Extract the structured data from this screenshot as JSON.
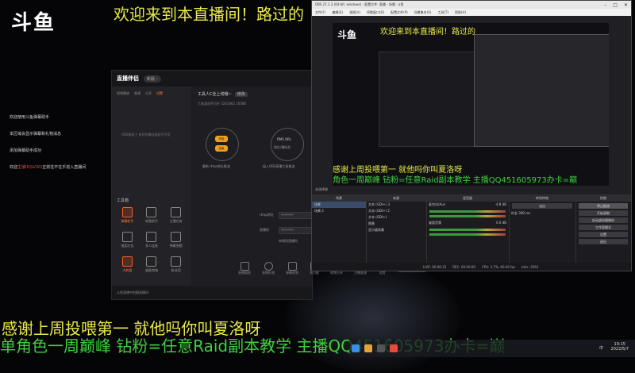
{
  "overlay": {
    "logo": "斗鱼",
    "top_ticker": "欢迎来到本直播间！路过的",
    "bottom_ticker_yellow": "感谢上周投喂第一 就他吗你叫夏洛呀",
    "bottom_ticker_green": "单角色一周巅峰 钻粉=任意Raid副本教学 主播QQ451605973办卡=巅"
  },
  "chat": {
    "lines": [
      {
        "text": "欢迎使用斗鱼弹幕助手",
        "highlight": ""
      },
      {
        "text": "本区域会显示弹幕和礼物消息",
        "highlight": ""
      },
      {
        "text": "添加弹幕助手成功",
        "highlight": ""
      },
      {
        "text": "欢迎",
        "highlight": "主播ID(LV30)"
      }
    ],
    "last_suffix": "正前往不在乎进入直播间"
  },
  "assistant": {
    "brand": "直播伴侣",
    "version_pill": "新版 ›",
    "tabs": [
      "视频播放",
      "普通",
      "分享",
      "设置"
    ],
    "active_tab": 3,
    "display_note": "OBS推流下 有好的最佳画质不可用",
    "room_title": "工具人C全上线哦~",
    "room_tag": "修改",
    "room_sub": "工具游戏不可开    3241662    16580",
    "btn_a": "开始",
    "btn_b": "结束",
    "rtmp_label": "RMS URL",
    "rtmp_sub": "地址/播码后",
    "hint_left": "重新 rtmp地址推流",
    "hint_right": "接入OBS直播工具推流",
    "field1_label": "rtmp地址",
    "field1_value": "********",
    "field2_label": "直播码",
    "field2_value": "********",
    "field_hint": "申请到直播码",
    "tools_header": "工具箱",
    "tools": [
      {
        "label": "弹幕助手",
        "active": true
      },
      {
        "label": "房管助手",
        "active": false
      },
      {
        "label": "主播任务",
        "active": false
      },
      {
        "label": "抽奖红包",
        "active": false
      },
      {
        "label": "多人连麦",
        "active": false
      },
      {
        "label": "弹幕答题",
        "active": false
      },
      {
        "label": "大转盘",
        "active": true
      },
      {
        "label": "福星商城",
        "active": false
      },
      {
        "label": "粉丝团",
        "active": false
      }
    ],
    "footer": "斗鱼直播中拍摄直播间",
    "bottom_icons": [
      "直播管理",
      "直播礼物",
      "弹幕视频",
      "多功能",
      "视频分享",
      "主播管理",
      "设置"
    ],
    "start_button": "开始直播"
  },
  "obs": {
    "window_title": "OBS 27.1.3 (64-bit, windows) - 配置文件: 直播 - 场景: 斗鱼",
    "menu": [
      "文件(F)",
      "编辑(E)",
      "视图(V)",
      "停靠窗口(D)",
      "配置文件(P)",
      "场景集合(S)",
      "工具(T)",
      "帮助(H)"
    ],
    "preview_title": "欢迎来到本直播间！路过的",
    "preview_yellow": "感谢上周投喂第一 就他吗你叫夏洛呀",
    "preview_green": "角色一周巅峰 钻粉=任意Raid副本教学 主播QQ451605973办卡=巅",
    "source_bar": "未选择源",
    "scenes_header": "场景",
    "scenes": [
      "场景",
      "场景 2"
    ],
    "sources_header": "来源",
    "sources": [
      "文本 (GDI+) 3",
      "文本 (GDI+) 2",
      "文本 (GDI+)",
      "图像",
      "显示器采集"
    ],
    "mixer_header": "混音器",
    "mixer": [
      {
        "name": "麦克风/Aux",
        "db": "-4.8 dB"
      },
      {
        "name": "桌面音频",
        "db": "0.0 dB"
      }
    ],
    "transition_header": "转场特效",
    "transition_name": "淡出",
    "duration_label": "时长",
    "duration_value": "300 ms",
    "controls_header": "控制",
    "controls": [
      "停止推流",
      "开始录制",
      "启动虚拟摄像机",
      "工作室模式",
      "设置",
      "退出"
    ],
    "status": [
      "LIVE: 00:06:32",
      "REC: 00:00:00",
      "CPU: 3.7%, 60.00 fps",
      "kb/s: 3592"
    ]
  },
  "taskbar": {
    "lang": "中",
    "time": "19:15",
    "date": "2022/6/7"
  }
}
